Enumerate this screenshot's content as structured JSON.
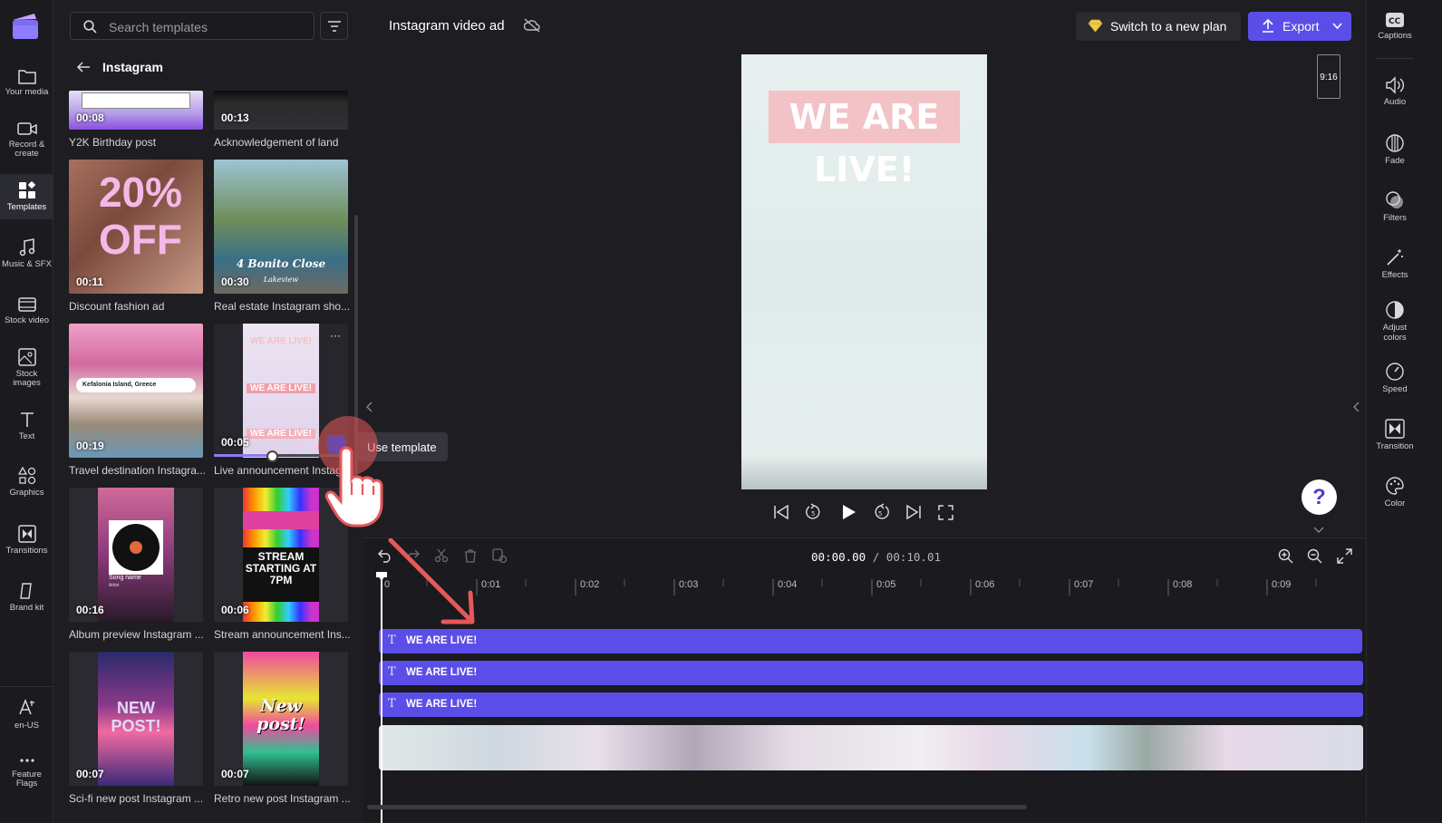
{
  "rail": {
    "items": [
      {
        "label": "Your media",
        "icon": "folder-icon"
      },
      {
        "label": "Record &",
        "label2": "create",
        "icon": "camera-icon"
      },
      {
        "label": "Templates",
        "icon": "templates-icon"
      },
      {
        "label": "Music & SFX",
        "icon": "music-icon"
      },
      {
        "label": "Stock video",
        "icon": "film-icon"
      },
      {
        "label": "Stock",
        "label2": "images",
        "icon": "image-icon"
      },
      {
        "label": "Text",
        "icon": "text-icon"
      },
      {
        "label": "Graphics",
        "icon": "shapes-icon"
      },
      {
        "label": "Transitions",
        "icon": "transition-icon"
      },
      {
        "label": "Brand kit",
        "icon": "brand-icon"
      },
      {
        "label": "en-US",
        "icon": "language-icon"
      },
      {
        "label": "Feature",
        "label2": "Flags",
        "icon": "more-icon"
      }
    ]
  },
  "panel": {
    "search_placeholder": "Search templates",
    "back_title": "Instagram",
    "templates": [
      {
        "duration": "00:08",
        "caption": "Y2K Birthday post"
      },
      {
        "duration": "00:13",
        "caption": "Acknowledgement of land"
      },
      {
        "duration": "00:11",
        "caption": "Discount fashion ad",
        "overlay": "20% OFF"
      },
      {
        "duration": "00:30",
        "caption": "Real estate Instagram sho...",
        "overlay": "4 Bonito Close",
        "overlay2": "Lakeview"
      },
      {
        "duration": "00:19",
        "caption": "Travel destination Instagra...",
        "overlay": "Kefalonia Island, Greece"
      },
      {
        "duration": "00:05",
        "caption": "Live announcement Instag...",
        "overlay": "WE ARE LIVE!"
      },
      {
        "duration": "00:16",
        "caption": "Album preview Instagram ...",
        "overlay": "Song name",
        "overlay2": "Artist"
      },
      {
        "duration": "00:06",
        "caption": "Stream announcement Ins...",
        "overlay": "STREAM STARTING AT 7PM"
      },
      {
        "duration": "00:07",
        "caption": "Sci-fi new post Instagram ...",
        "overlay": "NEW POST!"
      },
      {
        "duration": "00:07",
        "caption": "Retro new post Instagram ...",
        "overlay": "New post!"
      }
    ],
    "use_template_label": "Use template"
  },
  "topbar": {
    "project_title": "Instagram video ad",
    "plan_button": "Switch to a new plan",
    "export_button": "Export"
  },
  "preview": {
    "headline": "WE ARE LIVE!",
    "aspect_ratio": "9:16"
  },
  "right_rail": {
    "items": [
      {
        "label": "Captions",
        "icon": "captions-icon"
      },
      {
        "label": "Audio",
        "icon": "speaker-icon"
      },
      {
        "label": "Fade",
        "icon": "fade-icon"
      },
      {
        "label": "Filters",
        "icon": "filters-icon"
      },
      {
        "label": "Effects",
        "icon": "magic-wand-icon"
      },
      {
        "label": "Adjust",
        "label2": "colors",
        "icon": "contrast-icon"
      },
      {
        "label": "Speed",
        "icon": "speedometer-icon"
      },
      {
        "label": "Transition",
        "icon": "transition-icon"
      },
      {
        "label": "Color",
        "icon": "palette-icon"
      }
    ]
  },
  "timeline": {
    "current_time": "00:00.00",
    "total_time": "/ 00:10.01",
    "ticks": [
      "0",
      "0:01",
      "0:02",
      "0:03",
      "0:04",
      "0:05",
      "0:06",
      "0:07",
      "0:08",
      "0:09"
    ],
    "tracks": [
      "WE ARE LIVE!",
      "WE ARE LIVE!",
      "WE ARE LIVE!"
    ]
  },
  "colors": {
    "accent": "#5b4ee8",
    "cursor_highlight": "#e8585a"
  }
}
